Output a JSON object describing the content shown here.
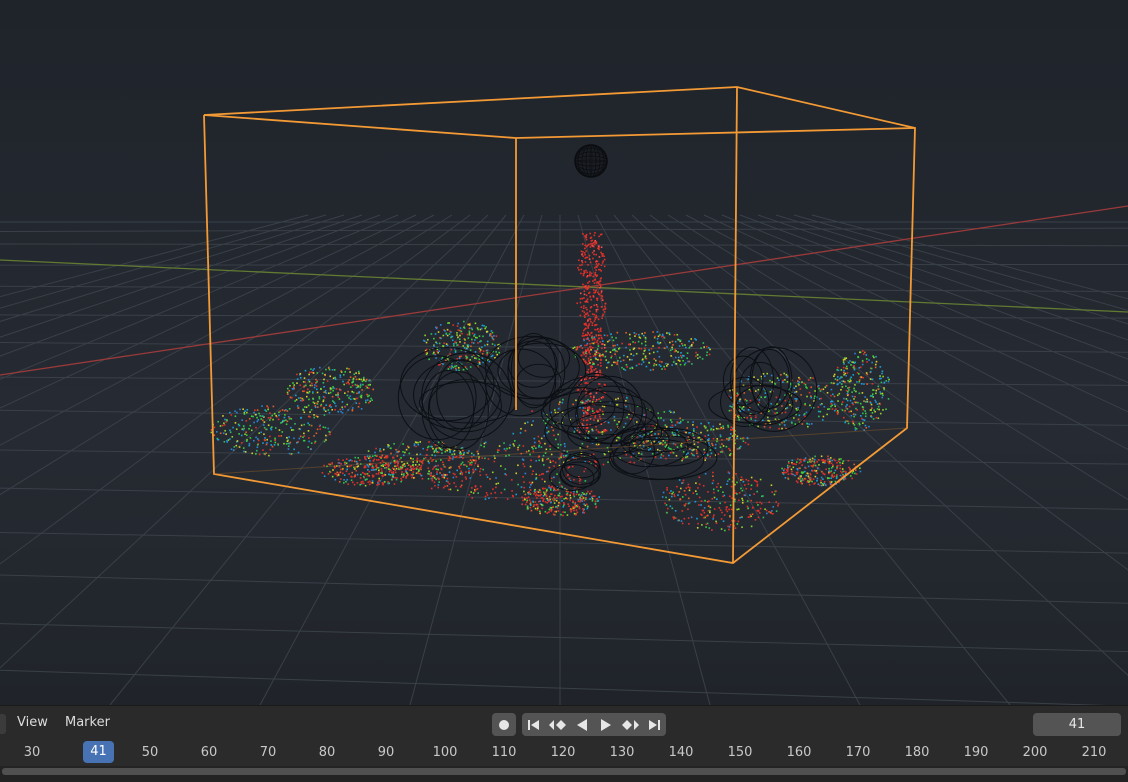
{
  "header": {
    "menus": [
      "View",
      "Marker"
    ],
    "current_frame": "41"
  },
  "timeline": {
    "current_frame": "41",
    "ticks": [
      "30",
      "50",
      "60",
      "70",
      "80",
      "90",
      "100",
      "110",
      "120",
      "130",
      "140",
      "150",
      "160",
      "170",
      "180",
      "190",
      "200",
      "210"
    ]
  },
  "colors": {
    "accent": "#4772b3",
    "domain_box": "#f39a35",
    "particles_red": "#e0302a",
    "x_axis": "#b04040",
    "y_axis": "#6e8a3a"
  },
  "icons": [
    "record-icon",
    "jump-to-start-icon",
    "jump-to-keyframe-prev-icon",
    "play-reverse-icon",
    "play-icon",
    "jump-to-keyframe-next-icon",
    "jump-to-end-icon"
  ]
}
